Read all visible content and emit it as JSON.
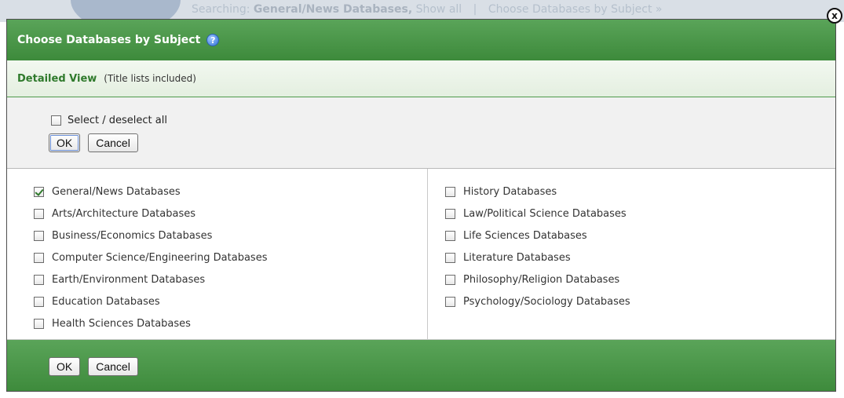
{
  "background": {
    "searching_label": "Searching:",
    "searching_value": "General/News Databases,",
    "show_all": "Show all",
    "separator": "|",
    "choose_link": "Choose Databases by Subject »"
  },
  "modal": {
    "title": "Choose Databases by Subject",
    "help_icon": "?",
    "close_icon": "x",
    "view_label": "Detailed View",
    "view_note": "(Title lists included)",
    "select_all_label": "Select / deselect all",
    "ok_label": "OK",
    "cancel_label": "Cancel"
  },
  "databases": {
    "left": [
      {
        "name": "General/News Databases",
        "checked": true
      },
      {
        "name": "Arts/Architecture Databases",
        "checked": false
      },
      {
        "name": "Business/Economics Databases",
        "checked": false
      },
      {
        "name": "Computer Science/Engineering Databases",
        "checked": false
      },
      {
        "name": "Earth/Environment Databases",
        "checked": false
      },
      {
        "name": "Education Databases",
        "checked": false
      },
      {
        "name": "Health Sciences Databases",
        "checked": false
      }
    ],
    "right": [
      {
        "name": "History Databases",
        "checked": false
      },
      {
        "name": "Law/Political Science Databases",
        "checked": false
      },
      {
        "name": "Life Sciences Databases",
        "checked": false
      },
      {
        "name": "Literature Databases",
        "checked": false
      },
      {
        "name": "Philosophy/Religion Databases",
        "checked": false
      },
      {
        "name": "Psychology/Sociology Databases",
        "checked": false
      }
    ]
  },
  "colors": {
    "header_green": "#4a9649",
    "detailed_view_green": "#2f7a2c"
  }
}
